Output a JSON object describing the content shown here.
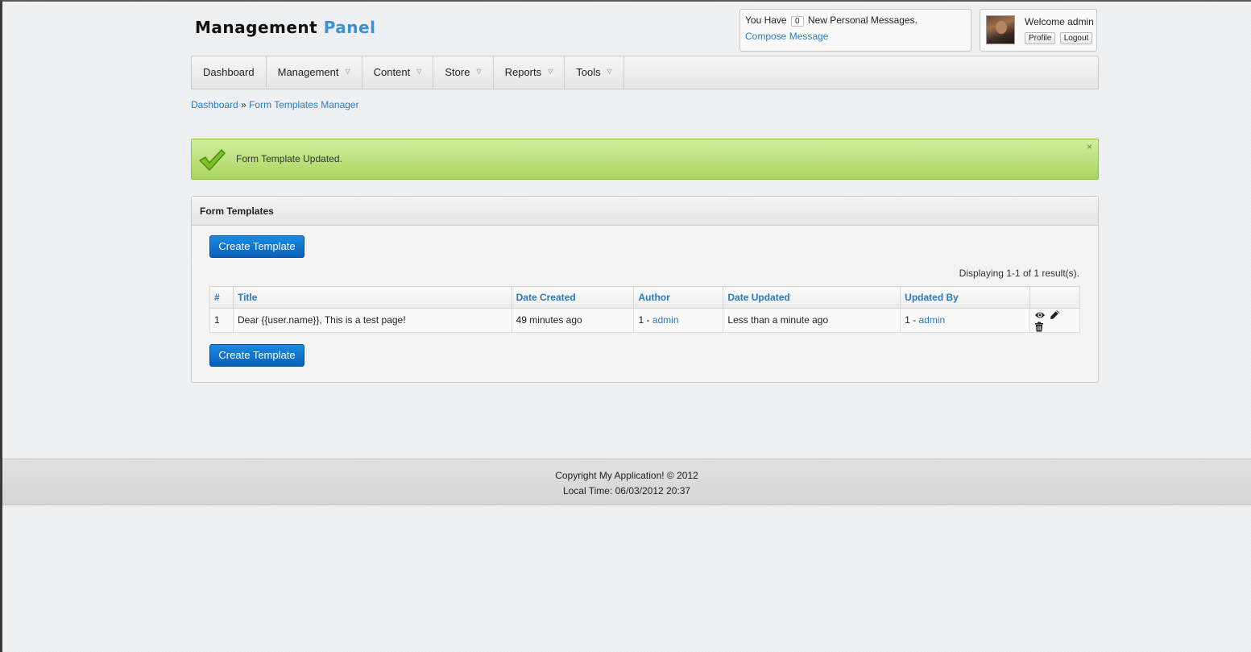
{
  "brand": {
    "part1": "Management",
    "part2": "Panel"
  },
  "messages": {
    "prefix": "You Have",
    "count": "0",
    "suffix": "New Personal Messages.",
    "compose": "Compose Message"
  },
  "user": {
    "welcome": "Welcome admin",
    "profile": "Profile",
    "logout": "Logout"
  },
  "nav": [
    {
      "label": "Dashboard",
      "dropdown": false
    },
    {
      "label": "Management",
      "dropdown": true
    },
    {
      "label": "Content",
      "dropdown": true
    },
    {
      "label": "Store",
      "dropdown": true
    },
    {
      "label": "Reports",
      "dropdown": true
    },
    {
      "label": "Tools",
      "dropdown": true
    }
  ],
  "breadcrumb": {
    "home": "Dashboard",
    "sep": "»",
    "current": "Form Templates Manager"
  },
  "alert": {
    "text": "Form Template Updated.",
    "close": "×"
  },
  "panel": {
    "title": "Form Templates",
    "create_label": "Create Template",
    "displaying": "Displaying 1-1 of 1 result(s).",
    "columns": [
      "#",
      "Title",
      "Date Created",
      "Author",
      "Date Updated",
      "Updated By",
      ""
    ],
    "rows": [
      {
        "id": "1",
        "title": "Dear {{user.name}}, This is a test page!",
        "created": "49 minutes ago",
        "author_prefix": "1 - ",
        "author": "admin",
        "updated": "Less than a minute ago",
        "updated_by_prefix": "1 - ",
        "updated_by": "admin"
      }
    ]
  },
  "footer": {
    "copyright": "Copyright My Application! © 2012",
    "local_time": "Local Time: 06/03/2012 20:37"
  },
  "colors": {
    "link": "#2a7ac0",
    "accent": "#3a93d0",
    "primary_button": "#0a6ccb",
    "alert_green": "#b6dd74"
  },
  "icons": {
    "view": "eye-icon",
    "edit": "pencil-icon",
    "delete": "trash-icon",
    "success": "checkmark-icon"
  }
}
